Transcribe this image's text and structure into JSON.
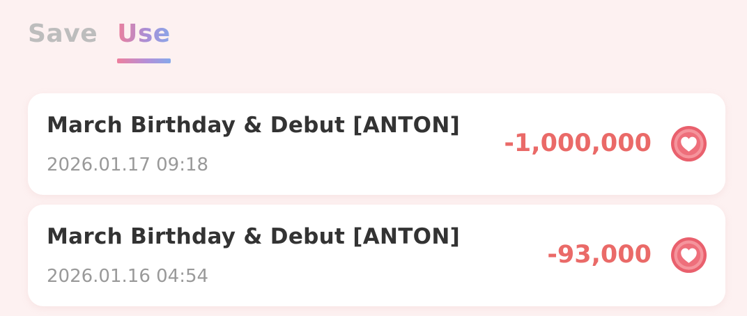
{
  "tabs": [
    {
      "label": "Save",
      "active": false
    },
    {
      "label": "Use",
      "active": true
    }
  ],
  "transactions": [
    {
      "title": "March Birthday & Debut [ANTON]",
      "date": "2026.01.17 09:18",
      "amount": "-1,000,000",
      "icon": "heart-icon"
    },
    {
      "title": "March Birthday & Debut [ANTON]",
      "date": "2026.01.16 04:54",
      "amount": "-93,000",
      "icon": "heart-icon"
    }
  ],
  "colors": {
    "background": "#fdf1f1",
    "amount": "#ea6a68",
    "heart": "#ea5f6b",
    "tab_inactive": "#bdbdbd",
    "tab_active_gradient": [
      "#ee7f9d",
      "#86a9ea"
    ]
  }
}
